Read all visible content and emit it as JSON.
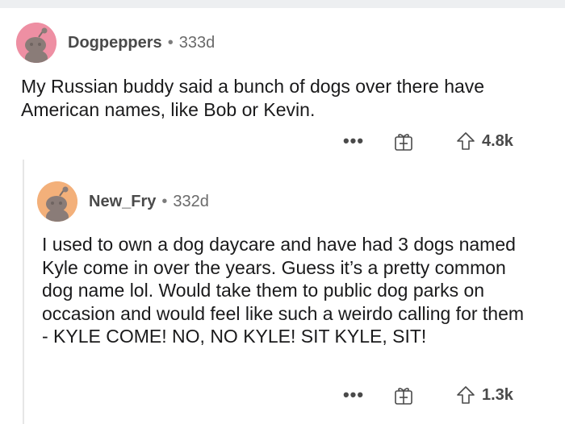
{
  "comments": [
    {
      "username": "Dogpeppers",
      "separator": "•",
      "age": "333d",
      "text": "My Russian buddy said a bunch of dogs over there have American names, like Bob or Kevin.",
      "more_label": "•••",
      "score": "4.8k",
      "avatar_color": "#ee8fa3"
    },
    {
      "username": "New_Fry",
      "separator": "•",
      "age": "332d",
      "text": "I used to own a dog daycare and have had 3 dogs named Kyle come in over the years. Guess it’s a pretty common dog name lol. Would take them to public dog parks on occasion and would feel like such a weirdo calling for them - KYLE COME! NO, NO KYLE! SIT KYLE, SIT!",
      "more_label": "•••",
      "score": "1.3k",
      "avatar_color": "#f3b07a"
    }
  ],
  "icons": {
    "more": "more-options-icon",
    "gift": "gift-award-icon",
    "upvote": "upvote-arrow-icon",
    "avatar": "snoo-avatar-icon"
  }
}
